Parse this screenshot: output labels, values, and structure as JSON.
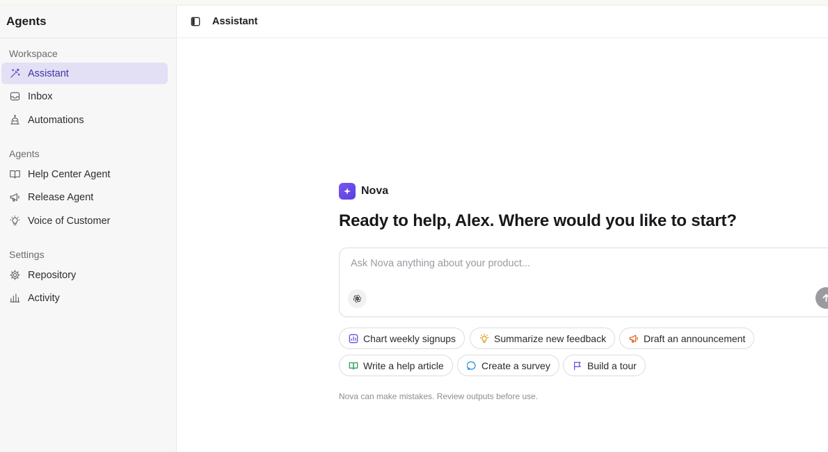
{
  "sidebar": {
    "title": "Agents",
    "sections": [
      {
        "label": "Workspace",
        "items": [
          {
            "label": "Assistant",
            "icon": "wand-icon",
            "active": true
          },
          {
            "label": "Inbox",
            "icon": "inbox-icon",
            "active": false
          },
          {
            "label": "Automations",
            "icon": "bot-icon",
            "active": false
          }
        ]
      },
      {
        "label": "Agents",
        "items": [
          {
            "label": "Help Center Agent",
            "icon": "book-open-icon",
            "active": false
          },
          {
            "label": "Release Agent",
            "icon": "megaphone-icon",
            "active": false
          },
          {
            "label": "Voice of Customer",
            "icon": "lightbulb-icon",
            "active": false
          }
        ]
      },
      {
        "label": "Settings",
        "items": [
          {
            "label": "Repository",
            "icon": "gear-icon",
            "active": false
          },
          {
            "label": "Activity",
            "icon": "bar-chart-icon",
            "active": false
          }
        ]
      }
    ]
  },
  "header": {
    "title": "Assistant",
    "toggle_icon": "panel-left-icon"
  },
  "assistant": {
    "name": "Nova",
    "greeting": "Ready to help, Alex. Where would you like to start?",
    "input_placeholder": "Ask Nova anything about your product...",
    "input_value": "",
    "model_icon": "openai-icon",
    "send_icon": "arrow-up-icon",
    "disclaimer": "Nova can make mistakes. Review outputs before use."
  },
  "suggestions": [
    {
      "label": "Chart weekly signups",
      "icon": "chart-icon",
      "color": "#6d4fe3"
    },
    {
      "label": "Summarize new feedback",
      "icon": "lightbulb-icon",
      "color": "#e0a21f"
    },
    {
      "label": "Draft an announcement",
      "icon": "megaphone-icon",
      "color": "#e06a2c"
    },
    {
      "label": "Write a help article",
      "icon": "book-open-icon",
      "color": "#2fa05a"
    },
    {
      "label": "Create a survey",
      "icon": "chat-bubble-icon",
      "color": "#2b8fd6"
    },
    {
      "label": "Build a tour",
      "icon": "flag-icon",
      "color": "#7a4fe3"
    }
  ],
  "colors": {
    "accent": "#5b3fe0",
    "active_nav_bg": "#e3e0f5",
    "active_nav_text": "#3e33a6"
  }
}
